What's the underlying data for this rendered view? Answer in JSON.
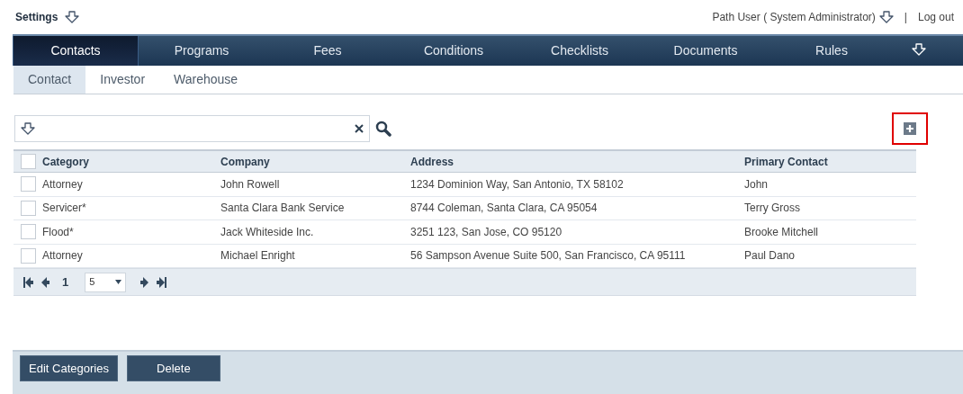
{
  "header": {
    "title": "Settings",
    "user": "Path User ( System Administrator)",
    "separator": "|",
    "logout": "Log out"
  },
  "nav_tabs": [
    {
      "label": "Contacts",
      "selected": true
    },
    {
      "label": "Programs",
      "selected": false
    },
    {
      "label": "Fees",
      "selected": false
    },
    {
      "label": "Conditions",
      "selected": false
    },
    {
      "label": "Checklists",
      "selected": false
    },
    {
      "label": "Documents",
      "selected": false
    },
    {
      "label": "Rules",
      "selected": false
    }
  ],
  "sub_tabs": [
    {
      "label": "Contact",
      "selected": true
    },
    {
      "label": "Investor",
      "selected": false
    },
    {
      "label": "Warehouse",
      "selected": false
    }
  ],
  "table": {
    "select_all_checked": false,
    "columns": [
      "Category",
      "Company",
      "Address",
      "Primary Contact"
    ],
    "rows": [
      {
        "checked": false,
        "cells": [
          "Attorney",
          "John Rowell",
          "1234 Dominion Way, San Antonio, TX 58102",
          "John"
        ]
      },
      {
        "checked": false,
        "cells": [
          "Servicer*",
          "Santa Clara Bank Service",
          "8744 Coleman, Santa Clara, CA 95054",
          "Terry Gross"
        ]
      },
      {
        "checked": false,
        "cells": [
          "Flood*",
          "Jack Whiteside Inc.",
          "3251 123, San Jose, CO 95120",
          "Brooke Mitchell"
        ]
      },
      {
        "checked": false,
        "cells": [
          "Attorney",
          "Michael Enright",
          "56 Sampson Avenue Suite 500, San Francisco, CA 95111",
          "Paul Dano"
        ]
      }
    ]
  },
  "pager": {
    "page": "1",
    "page_size": "5"
  },
  "buttons": [
    "Edit Categories",
    "Delete"
  ]
}
